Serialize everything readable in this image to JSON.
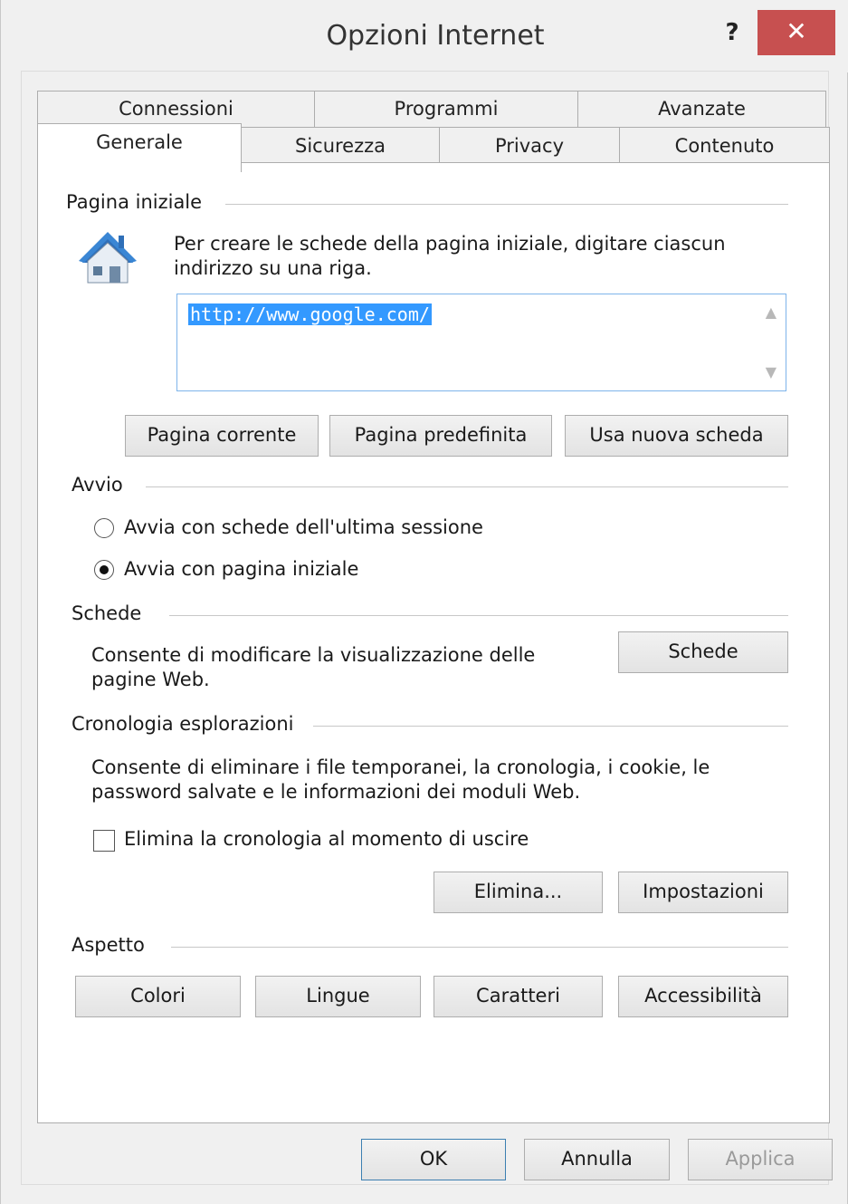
{
  "window": {
    "title": "Opzioni Internet",
    "help_label": "?",
    "close_label": "✕"
  },
  "tabs_back": [
    "Connessioni",
    "Programmi",
    "Avanzate"
  ],
  "tabs_front": [
    "Generale",
    "Sicurezza",
    "Privacy",
    "Contenuto"
  ],
  "home_page": {
    "group_label": "Pagina iniziale",
    "icon": "house-icon",
    "description": "Per creare le schede della pagina iniziale, digitare ciascun indirizzo su una riga.",
    "url_value": "http://www.google.com/",
    "buttons": {
      "current": "Pagina corrente",
      "default": "Pagina predefinita",
      "new_tab": "Usa nuova scheda"
    }
  },
  "startup": {
    "group_label": "Avvio",
    "option_last_session": "Avvia con schede dell'ultima sessione",
    "option_home_page": "Avvia con pagina iniziale",
    "selected": "home_page"
  },
  "tabs_section": {
    "group_label": "Schede",
    "description": "Consente di modificare la visualizzazione delle pagine Web.",
    "button": "Schede"
  },
  "history": {
    "group_label": "Cronologia esplorazioni",
    "description": "Consente di eliminare i file temporanei, la cronologia, i cookie, le password salvate e le informazioni dei moduli Web.",
    "checkbox_label": "Elimina la cronologia al momento di uscire",
    "checkbox_checked": false,
    "delete_button": "Elimina...",
    "settings_button": "Impostazioni"
  },
  "appearance": {
    "group_label": "Aspetto",
    "buttons": {
      "colors": "Colori",
      "languages": "Lingue",
      "fonts": "Caratteri",
      "accessibility": "Accessibilità"
    }
  },
  "footer": {
    "ok": "OK",
    "cancel": "Annulla",
    "apply": "Applica"
  },
  "colors": {
    "close_button": "#c75050",
    "selection": "#3399ff",
    "default_button_border": "#3c7fb1"
  }
}
